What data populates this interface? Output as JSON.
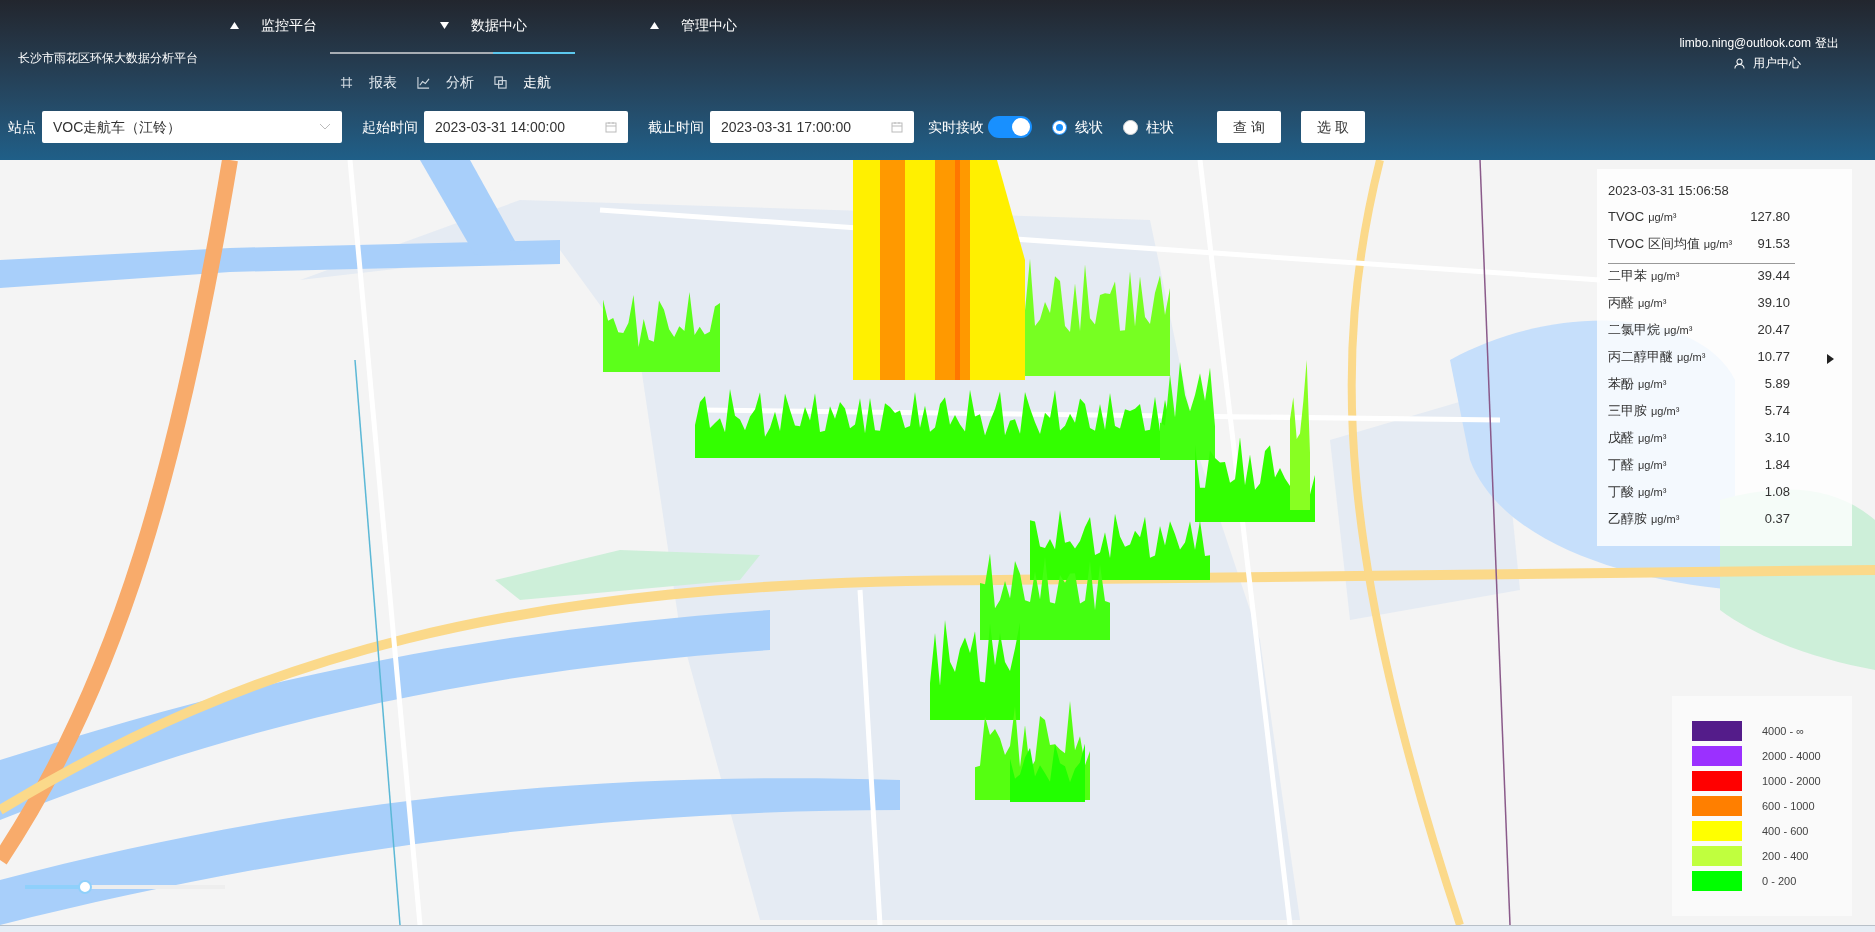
{
  "header": {
    "platform_title": "长沙市雨花区环保大数据分析平台",
    "nav": [
      {
        "label": "监控平台",
        "expanded": false
      },
      {
        "label": "数据中心",
        "expanded": true
      },
      {
        "label": "管理中心",
        "expanded": false
      }
    ],
    "subnav": [
      {
        "label": "报表",
        "selected": false
      },
      {
        "label": "分析",
        "selected": false
      },
      {
        "label": "走航",
        "selected": true
      }
    ],
    "user": {
      "email": "limbo.ning@outlook.com",
      "logout": "登出",
      "center": "用户中心"
    }
  },
  "toolbar": {
    "station_label": "站点",
    "station_value": "VOC走航车（江铃）",
    "start_label": "起始时间",
    "start_value": "2023-03-31 14:00:00",
    "end_label": "截止时间",
    "end_value": "2023-03-31 17:00:00",
    "realtime_label": "实时接收",
    "realtime_on": true,
    "chart_types": [
      {
        "label": "线状",
        "selected": true
      },
      {
        "label": "柱状",
        "selected": false
      }
    ],
    "buttons": [
      "查 询",
      "选 取"
    ]
  },
  "info_panel": {
    "time": "2023-03-31 15:06:58",
    "summary": [
      {
        "name": "TVOC",
        "unit": "μg/m³",
        "value": "127.80"
      },
      {
        "name": "TVOC 区间均值",
        "unit": "μg/m³",
        "value": "91.53"
      }
    ],
    "rows": [
      {
        "name": "二甲苯",
        "unit": "μg/m³",
        "value": "39.44",
        "pointer": false
      },
      {
        "name": "丙醛",
        "unit": "μg/m³",
        "value": "39.10",
        "pointer": false
      },
      {
        "name": "二氯甲烷",
        "unit": "μg/m³",
        "value": "20.47",
        "pointer": false
      },
      {
        "name": "丙二醇甲醚",
        "unit": "μg/m³",
        "value": "10.77",
        "pointer": true
      },
      {
        "name": "苯酚",
        "unit": "μg/m³",
        "value": "5.89",
        "pointer": false
      },
      {
        "name": "三甲胺",
        "unit": "μg/m³",
        "value": "5.74",
        "pointer": false
      },
      {
        "name": "戊醛",
        "unit": "μg/m³",
        "value": "3.10",
        "pointer": false
      },
      {
        "name": "丁醛",
        "unit": "μg/m³",
        "value": "1.84",
        "pointer": false
      },
      {
        "name": "丁酸",
        "unit": "μg/m³",
        "value": "1.08",
        "pointer": false
      },
      {
        "name": "乙醇胺",
        "unit": "μg/m³",
        "value": "0.37",
        "pointer": false
      }
    ]
  },
  "legend": [
    {
      "label": "4000 - ∞",
      "color": "#541c8a"
    },
    {
      "label": "2000 - 4000",
      "color": "#9b30ff"
    },
    {
      "label": "1000 - 2000",
      "color": "#ff0000"
    },
    {
      "label": "600 - 1000",
      "color": "#ff7f00"
    },
    {
      "label": "400 - 600",
      "color": "#ffff00"
    },
    {
      "label": "200 - 400",
      "color": "#c0ff3e"
    },
    {
      "label": "0 - 200",
      "color": "#00ff00"
    }
  ],
  "zoom_slider": {
    "level": 0.3
  }
}
